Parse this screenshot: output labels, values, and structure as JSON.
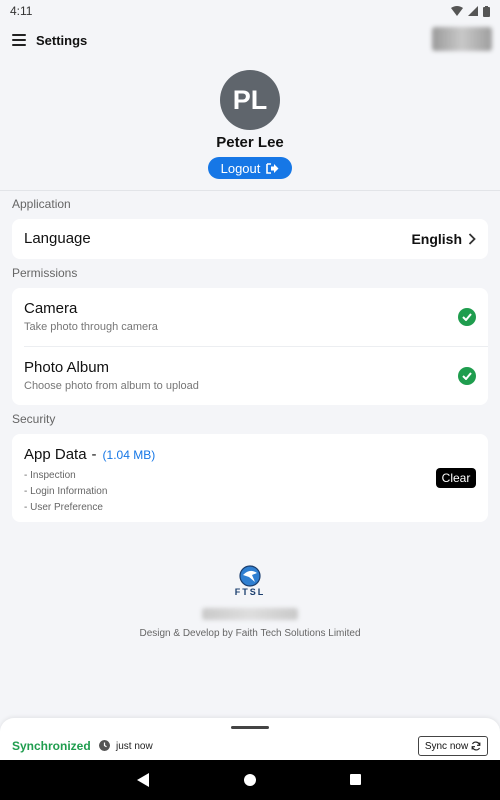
{
  "status_bar": {
    "time": "4:11"
  },
  "app_bar": {
    "title": "Settings"
  },
  "profile": {
    "initials": "PL",
    "name": "Peter Lee",
    "logout_label": "Logout"
  },
  "sections": {
    "application": {
      "header": "Application",
      "language": {
        "label": "Language",
        "value": "English"
      }
    },
    "permissions": {
      "header": "Permissions",
      "camera": {
        "title": "Camera",
        "subtitle": "Take photo through camera"
      },
      "photo_album": {
        "title": "Photo Album",
        "subtitle": "Choose photo from album to upload"
      }
    },
    "security": {
      "header": "Security",
      "app_data": {
        "title": "App Data",
        "separator": "-",
        "size": "(1.04 MB)",
        "items": [
          "- Inspection",
          "- Login Information",
          "- User Preference"
        ],
        "clear_label": "Clear"
      }
    }
  },
  "footer": {
    "logo_text": "FTSL",
    "credit": "Design & Develop by Faith Tech Solutions Limited"
  },
  "sync": {
    "status": "Synchronized",
    "time": "just now",
    "button_label": "Sync now"
  },
  "colors": {
    "accent": "#1677e6",
    "success": "#1f9d4e",
    "avatar": "#5f656c"
  }
}
